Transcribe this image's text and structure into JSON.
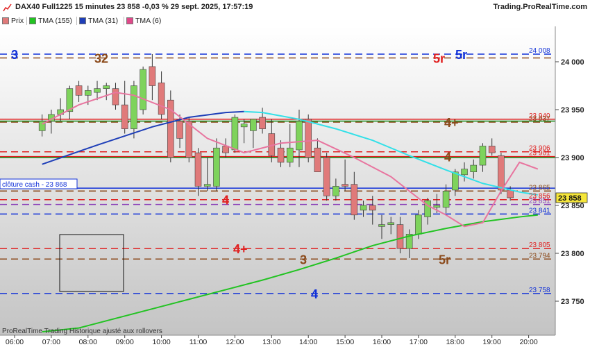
{
  "header": {
    "title": "DAX40 Full1225 15 minutes 23 858 -0,03 % 29 sept. 2025, 17:57:19",
    "site": "Trading.ProRealTime.com"
  },
  "legend": [
    {
      "label": "Prix",
      "color": "#e07a7a"
    },
    {
      "label": "TMA (155)",
      "color": "#22c322"
    },
    {
      "label": "TMA (31)",
      "color": "#1f3fb8"
    },
    {
      "label": "TMA (6)",
      "color": "#e0498a"
    }
  ],
  "footer": "ProRealTime Trading  Historique ajusté aux rollovers",
  "close_label": "clôture cash -  23 868",
  "colors": {
    "up": "#7ed35c",
    "down": "#e07a7a",
    "tma155": "#22c322",
    "tma31": "#1f3fb8",
    "tma31b": "#33e0e8",
    "tma6": "#e8759f",
    "tma6b": "#8b1f2d",
    "blue": "#1030d8",
    "red": "#e02020",
    "green": "#188a18",
    "brown": "#8b4a1b",
    "purple": "#8a3fb8"
  },
  "chart_data": {
    "type": "candlestick",
    "y_ticks": [
      23750,
      23800,
      23850,
      23900,
      23950,
      24000
    ],
    "x_ticks": [
      "06:00",
      "07:00",
      "08:00",
      "09:00",
      "10:00",
      "11:00",
      "12:00",
      "13:00",
      "14:00",
      "15:00",
      "16:00",
      "17:00",
      "18:00",
      "19:00",
      "20:00"
    ],
    "last_price": {
      "value": 23858,
      "label": "23 858"
    },
    "candles": [
      {
        "t": "06:45",
        "o": 23928,
        "h": 23945,
        "l": 23922,
        "c": 23938
      },
      {
        "t": "07:00",
        "o": 23938,
        "h": 23950,
        "l": 23925,
        "c": 23945
      },
      {
        "t": "07:15",
        "o": 23945,
        "h": 23962,
        "l": 23938,
        "c": 23950
      },
      {
        "t": "07:30",
        "o": 23948,
        "h": 23975,
        "l": 23940,
        "c": 23972
      },
      {
        "t": "07:45",
        "o": 23975,
        "h": 23980,
        "l": 23958,
        "c": 23965
      },
      {
        "t": "08:00",
        "o": 23965,
        "h": 23975,
        "l": 23955,
        "c": 23970
      },
      {
        "t": "08:15",
        "o": 23968,
        "h": 23980,
        "l": 23960,
        "c": 23972
      },
      {
        "t": "08:30",
        "o": 23972,
        "h": 23978,
        "l": 23960,
        "c": 23975
      },
      {
        "t": "08:45",
        "o": 23972,
        "h": 23978,
        "l": 23950,
        "c": 23955
      },
      {
        "t": "09:00",
        "o": 23955,
        "h": 23980,
        "l": 23925,
        "c": 23930
      },
      {
        "t": "09:15",
        "o": 23930,
        "h": 23980,
        "l": 23920,
        "c": 23975
      },
      {
        "t": "09:30",
        "o": 23950,
        "h": 23995,
        "l": 23945,
        "c": 23992
      },
      {
        "t": "09:45",
        "o": 23995,
        "h": 24008,
        "l": 23960,
        "c": 23975
      },
      {
        "t": "10:00",
        "o": 23978,
        "h": 23990,
        "l": 23940,
        "c": 23945
      },
      {
        "t": "10:15",
        "o": 23960,
        "h": 23970,
        "l": 23895,
        "c": 23900
      },
      {
        "t": "10:30",
        "o": 23938,
        "h": 23945,
        "l": 23910,
        "c": 23920
      },
      {
        "t": "10:45",
        "o": 23938,
        "h": 23942,
        "l": 23895,
        "c": 23900
      },
      {
        "t": "11:00",
        "o": 23905,
        "h": 23910,
        "l": 23860,
        "c": 23870
      },
      {
        "t": "11:15",
        "o": 23870,
        "h": 23900,
        "l": 23865,
        "c": 23872
      },
      {
        "t": "11:30",
        "o": 23870,
        "h": 23920,
        "l": 23865,
        "c": 23910
      },
      {
        "t": "11:45",
        "o": 23912,
        "h": 23920,
        "l": 23900,
        "c": 23905
      },
      {
        "t": "12:00",
        "o": 23908,
        "h": 23945,
        "l": 23905,
        "c": 23942
      },
      {
        "t": "12:15",
        "o": 23932,
        "h": 23940,
        "l": 23915,
        "c": 23935
      },
      {
        "t": "12:30",
        "o": 23928,
        "h": 23940,
        "l": 23910,
        "c": 23940
      },
      {
        "t": "12:45",
        "o": 23942,
        "h": 23952,
        "l": 23925,
        "c": 23930
      },
      {
        "t": "13:00",
        "o": 23925,
        "h": 23940,
        "l": 23895,
        "c": 23902
      },
      {
        "t": "13:15",
        "o": 23910,
        "h": 23918,
        "l": 23890,
        "c": 23895
      },
      {
        "t": "13:30",
        "o": 23895,
        "h": 23935,
        "l": 23890,
        "c": 23910
      },
      {
        "t": "13:45",
        "o": 23908,
        "h": 23950,
        "l": 23890,
        "c": 23938
      },
      {
        "t": "14:00",
        "o": 23940,
        "h": 23945,
        "l": 23895,
        "c": 23900
      },
      {
        "t": "14:15",
        "o": 23910,
        "h": 23920,
        "l": 23885,
        "c": 23885
      },
      {
        "t": "14:30",
        "o": 23900,
        "h": 23905,
        "l": 23855,
        "c": 23860
      },
      {
        "t": "14:45",
        "o": 23860,
        "h": 23878,
        "l": 23855,
        "c": 23870
      },
      {
        "t": "15:00",
        "o": 23872,
        "h": 23898,
        "l": 23865,
        "c": 23870
      },
      {
        "t": "15:15",
        "o": 23872,
        "h": 23885,
        "l": 23835,
        "c": 23840
      },
      {
        "t": "15:30",
        "o": 23845,
        "h": 23855,
        "l": 23838,
        "c": 23850
      },
      {
        "t": "15:45",
        "o": 23850,
        "h": 23860,
        "l": 23830,
        "c": 23845
      },
      {
        "t": "16:00",
        "o": 23828,
        "h": 23840,
        "l": 23815,
        "c": 23830
      },
      {
        "t": "16:15",
        "o": 23830,
        "h": 23838,
        "l": 23820,
        "c": 23832
      },
      {
        "t": "16:30",
        "o": 23830,
        "h": 23838,
        "l": 23800,
        "c": 23805
      },
      {
        "t": "16:45",
        "o": 23805,
        "h": 23825,
        "l": 23795,
        "c": 23820
      },
      {
        "t": "17:00",
        "o": 23820,
        "h": 23845,
        "l": 23815,
        "c": 23840
      },
      {
        "t": "17:15",
        "o": 23838,
        "h": 23858,
        "l": 23830,
        "c": 23855
      },
      {
        "t": "17:30",
        "o": 23848,
        "h": 23862,
        "l": 23842,
        "c": 23850
      },
      {
        "t": "17:45",
        "o": 23848,
        "h": 23872,
        "l": 23842,
        "c": 23865
      },
      {
        "t": "18:00",
        "o": 23866,
        "h": 23888,
        "l": 23860,
        "c": 23885
      },
      {
        "t": "18:15",
        "o": 23882,
        "h": 23895,
        "l": 23875,
        "c": 23888
      },
      {
        "t": "18:30",
        "o": 23885,
        "h": 23898,
        "l": 23878,
        "c": 23892
      },
      {
        "t": "18:45",
        "o": 23892,
        "h": 23915,
        "l": 23885,
        "c": 23912
      },
      {
        "t": "19:00",
        "o": 23912,
        "h": 23920,
        "l": 23902,
        "c": 23905
      },
      {
        "t": "19:15",
        "o": 23902,
        "h": 23905,
        "l": 23862,
        "c": 23866
      },
      {
        "t": "19:30",
        "o": 23866,
        "h": 23870,
        "l": 23855,
        "c": 23858
      }
    ],
    "levels": [
      {
        "price": 24008,
        "color": "#1030d8",
        "style": "dashed",
        "label": "24 008",
        "side_labels": [
          {
            "text": "3",
            "pos": 0.02,
            "color": "#1030d8"
          },
          {
            "text": "5r",
            "pos": 0.82,
            "color": "#1030d8"
          }
        ]
      },
      {
        "price": 24004,
        "color": "#8b4a1b",
        "style": "dashed",
        "label": "",
        "side_labels": [
          {
            "text": "32",
            "pos": 0.17,
            "color": "#8b4a1b"
          },
          {
            "text": "5r",
            "pos": 0.78,
            "color": "#e02020"
          }
        ]
      },
      {
        "price": 23940,
        "color": "#e02020",
        "style": "solid",
        "label": "23 940",
        "side_labels": []
      },
      {
        "price": 23937,
        "color": "#8b4a1b",
        "style": "dashed",
        "label": "23 937",
        "side_labels": [
          {
            "text": "4+",
            "pos": 0.8,
            "color": "#8b4a1b"
          }
        ]
      },
      {
        "price": 23938,
        "color": "#188a18",
        "style": "solid",
        "label": "",
        "side_labels": []
      },
      {
        "price": 23906,
        "color": "#e02020",
        "style": "dashed",
        "label": "23 906",
        "side_labels": []
      },
      {
        "price": 23901,
        "color": "#e02020",
        "style": "solid",
        "label": "23 901",
        "side_labels": [
          {
            "text": "4",
            "pos": 0.8,
            "color": "#8b4a1b"
          }
        ]
      },
      {
        "price": 23900,
        "color": "#188a18",
        "style": "solid",
        "label": "",
        "side_labels": []
      },
      {
        "price": 23868,
        "color": "#1030d8",
        "style": "solid",
        "label": "",
        "side_labels": []
      },
      {
        "price": 23865,
        "color": "#8b4a1b",
        "style": "dashed",
        "label": "23 865",
        "side_labels": []
      },
      {
        "price": 23856,
        "color": "#e02020",
        "style": "dashed",
        "label": "23 856",
        "side_labels": [
          {
            "text": "4",
            "pos": 0.4,
            "color": "#e02020"
          }
        ]
      },
      {
        "price": 23851,
        "color": "#8a3fb8",
        "style": "dashed",
        "label": "23 851",
        "side_labels": []
      },
      {
        "price": 23841,
        "color": "#1030d8",
        "style": "dashed",
        "label": "23 841",
        "side_labels": []
      },
      {
        "price": 23805,
        "color": "#e02020",
        "style": "dashed",
        "label": "23 805",
        "side_labels": [
          {
            "text": "4+",
            "pos": 0.42,
            "color": "#e02020"
          }
        ]
      },
      {
        "price": 23794,
        "color": "#8b4a1b",
        "style": "dashed",
        "label": "23 794",
        "side_labels": [
          {
            "text": "3",
            "pos": 0.54,
            "color": "#8b4a1b"
          },
          {
            "text": "5r",
            "pos": 0.79,
            "color": "#8b4a1b"
          }
        ]
      },
      {
        "price": 23758,
        "color": "#1030d8",
        "style": "dashed",
        "label": "23 758",
        "side_labels": [
          {
            "text": "4",
            "pos": 0.56,
            "color": "#1030d8"
          }
        ]
      }
    ],
    "tma155": [
      [
        0,
        23718
      ],
      [
        4,
        23722
      ],
      [
        8,
        23732
      ],
      [
        12,
        23742
      ],
      [
        16,
        23752
      ],
      [
        20,
        23762
      ],
      [
        24,
        23772
      ],
      [
        28,
        23783
      ],
      [
        32,
        23795
      ],
      [
        36,
        23808
      ],
      [
        40,
        23818
      ],
      [
        44,
        23826
      ],
      [
        48,
        23833
      ],
      [
        52,
        23838
      ],
      [
        54,
        23840
      ]
    ],
    "tma31": [
      [
        0,
        23893
      ],
      [
        6,
        23913
      ],
      [
        12,
        23932
      ],
      [
        16,
        23942
      ],
      [
        20,
        23947
      ],
      [
        22,
        23948
      ],
      [
        24,
        23947
      ],
      [
        28,
        23940
      ],
      [
        32,
        23930
      ],
      [
        36,
        23918
      ],
      [
        40,
        23902
      ],
      [
        44,
        23887
      ],
      [
        48,
        23873
      ],
      [
        52,
        23864
      ],
      [
        54,
        23861
      ]
    ],
    "tma6": [
      [
        0,
        23935
      ],
      [
        4,
        23955
      ],
      [
        8,
        23968
      ],
      [
        10,
        23965
      ],
      [
        14,
        23950
      ],
      [
        18,
        23920
      ],
      [
        22,
        23905
      ],
      [
        26,
        23915
      ],
      [
        30,
        23918
      ],
      [
        34,
        23900
      ],
      [
        38,
        23880
      ],
      [
        42,
        23850
      ],
      [
        44,
        23840
      ],
      [
        46,
        23828
      ],
      [
        48,
        23832
      ],
      [
        50,
        23865
      ],
      [
        52,
        23895
      ],
      [
        54,
        23888
      ]
    ]
  }
}
